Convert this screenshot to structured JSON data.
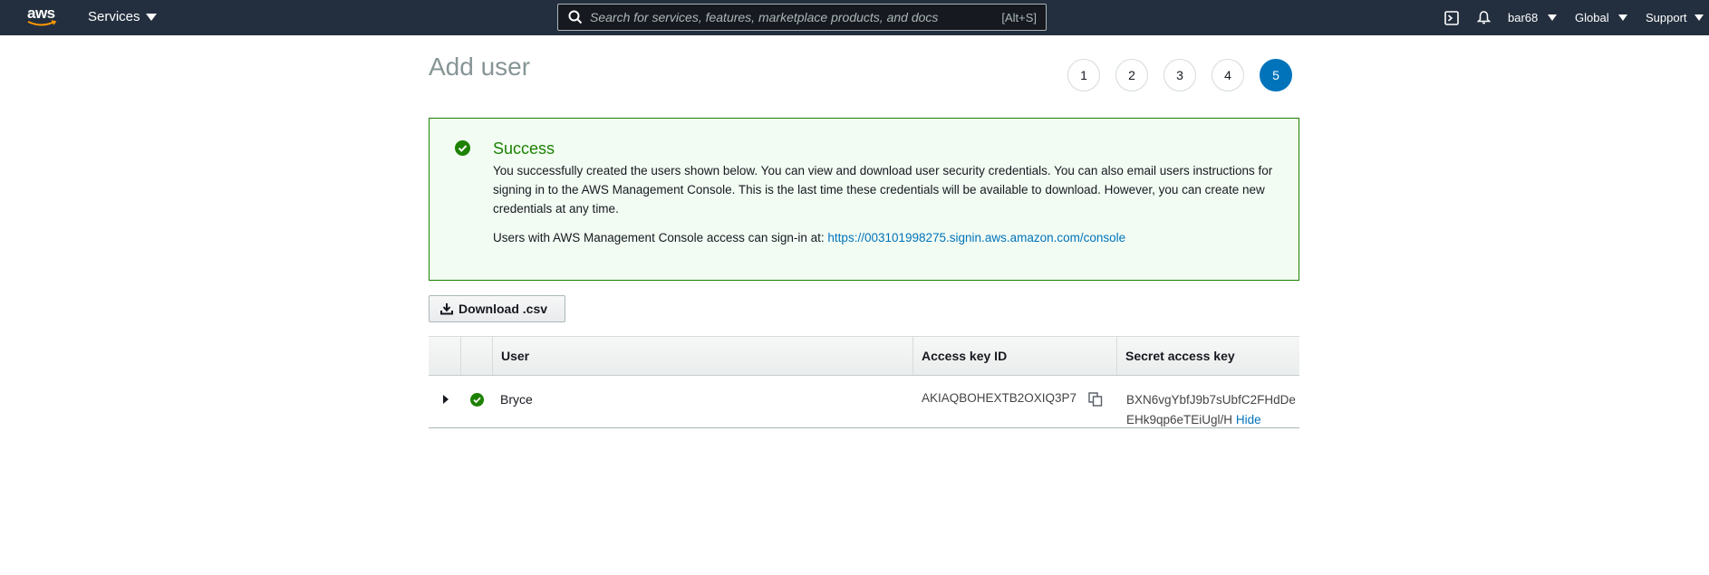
{
  "topnav": {
    "logo_text": "aws",
    "services_label": "Services",
    "search_placeholder": "Search for services, features, marketplace products, and docs",
    "search_shortcut": "[Alt+S]",
    "account": "bar68",
    "region": "Global",
    "support": "Support"
  },
  "page": {
    "title": "Add user",
    "steps": [
      "1",
      "2",
      "3",
      "4",
      "5"
    ],
    "active_step": "5"
  },
  "alert": {
    "heading": "Success",
    "body": "You successfully created the users shown below. You can view and download user security credentials. You can also email users instructions for signing in to the AWS Management Console. This is the last time these credentials will be available to download. However, you can create new credentials at any time.",
    "signin_prefix": "Users with AWS Management Console access can sign-in at: ",
    "signin_url": "https://003101998275.signin.aws.amazon.com/console"
  },
  "download_label": "Download .csv",
  "table": {
    "headers": [
      "",
      "",
      "User",
      "Access key ID",
      "Secret access key"
    ],
    "rows": [
      {
        "user": "Bryce",
        "access_key_id": "AKIAQBOHEXTB2OXIQ3P7",
        "secret_key": "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",
        "secret_action": "Hide"
      }
    ]
  },
  "colors": {
    "nav_bg": "#232f3e",
    "success": "#1d8102",
    "link": "#0073bb"
  }
}
